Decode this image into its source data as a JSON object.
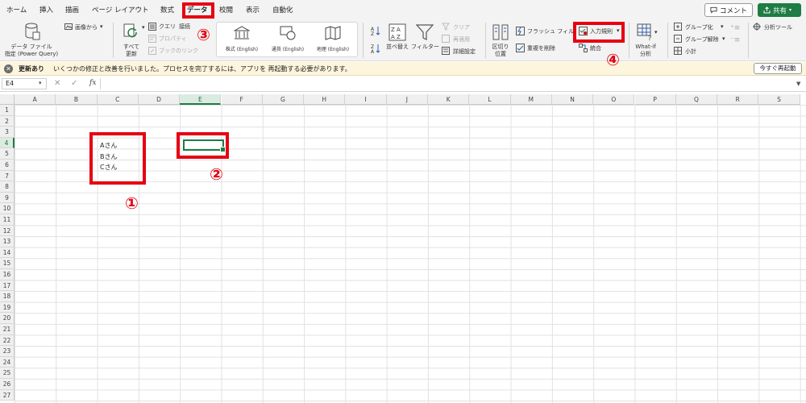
{
  "menu": {
    "tabs": [
      "ホーム",
      "挿入",
      "描画",
      "ページ レイアウト",
      "数式",
      "データ",
      "校閲",
      "表示",
      "自動化"
    ],
    "active_tab": "データ",
    "comment_label": "コメント",
    "share_label": "共有"
  },
  "ribbon": {
    "get_data_line1": "データ ファイル",
    "get_data_line2": "指定 (Power Query)",
    "from_picture": "画像から",
    "refresh_all_line1": "すべて",
    "refresh_all_line2": "更新",
    "queries": "クエリ",
    "connections": "接続",
    "properties": "プロパティ",
    "book_links": "ブックのリンク",
    "stocks": "株式 (English)",
    "currencies": "通貨 (English)",
    "geography": "地理 (English)",
    "sort": "並べ替え",
    "filter": "フィルター",
    "clear": "クリア",
    "reapply": "再適用",
    "advanced": "詳細設定",
    "text_to_columns_line1": "区切り",
    "text_to_columns_line2": "位置",
    "flash_fill": "フラッシュ フィル",
    "remove_duplicates": "重複を削除",
    "data_validation": "入力規則",
    "consolidate": "統合",
    "whatif_line1": "What-if",
    "whatif_line2": "分析",
    "group": "グループ化",
    "ungroup": "グループ解除",
    "subtotal": "小計",
    "analysis_tools": "分析ツール"
  },
  "message_bar": {
    "title": "更新あり",
    "text": "いくつかの修正と改善を行いました。プロセスを完了するには、アプリを 再起動する必要があります。",
    "restart_label": "今すぐ再起動"
  },
  "formula_bar": {
    "name_box": "E4",
    "fx": "fx",
    "value": ""
  },
  "grid": {
    "columns": [
      "A",
      "B",
      "C",
      "D",
      "E",
      "F",
      "G",
      "H",
      "I",
      "J",
      "K",
      "L",
      "M",
      "N",
      "O",
      "P",
      "Q",
      "R",
      "S"
    ],
    "rows": [
      "1",
      "2",
      "3",
      "4",
      "5",
      "6",
      "7",
      "8",
      "9",
      "10",
      "11",
      "12",
      "13",
      "14",
      "15",
      "16",
      "17",
      "18",
      "19",
      "20",
      "21",
      "22",
      "23",
      "24",
      "25",
      "26",
      "27"
    ],
    "selected_cell": "E4",
    "cells": [
      {
        "ref": "C4",
        "value": "Aさん"
      },
      {
        "ref": "C5",
        "value": "Bさん"
      },
      {
        "ref": "C6",
        "value": "Cさん"
      }
    ]
  },
  "annotations": [
    "①",
    "②",
    "③",
    "④"
  ],
  "colors": {
    "accent_green": "#1e7c44",
    "annotation_red": "#e60012",
    "message_bar_bg": "#fdf5dc"
  }
}
